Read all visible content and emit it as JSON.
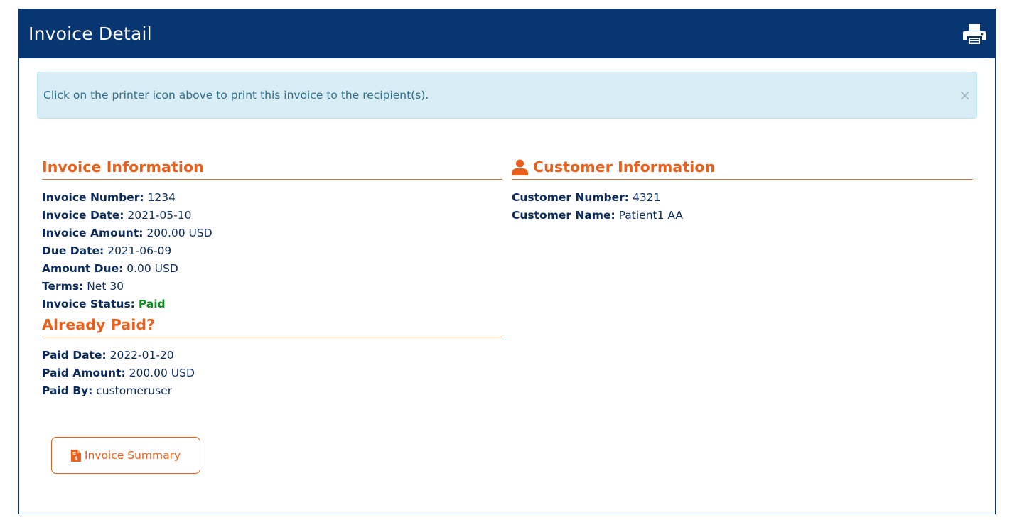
{
  "header": {
    "title": "Invoice Detail",
    "print_icon": "printer-icon"
  },
  "alert": {
    "message": "Click on the printer icon above to print this invoice to the recipient(s).",
    "close_label": "×"
  },
  "invoice_info": {
    "title": "Invoice Information",
    "fields": [
      {
        "label": "Invoice Number:",
        "value": "1234"
      },
      {
        "label": "Invoice Date:",
        "value": "2021-05-10"
      },
      {
        "label": "Invoice Amount:",
        "value": "200.00 USD"
      },
      {
        "label": "Due Date:",
        "value": "2021-06-09"
      },
      {
        "label": "Amount Due:",
        "value": "0.00 USD"
      },
      {
        "label": "Terms:",
        "value": "Net 30"
      },
      {
        "label": "Invoice Status:",
        "value": "Paid"
      }
    ]
  },
  "already_paid": {
    "title": "Already Paid?",
    "fields": [
      {
        "label": "Paid Date:",
        "value": "2022-01-20"
      },
      {
        "label": "Paid Amount:",
        "value": "200.00 USD"
      },
      {
        "label": "Paid By:",
        "value": "customeruser"
      }
    ]
  },
  "customer_info": {
    "title": "Customer Information",
    "icon": "user-icon",
    "fields": [
      {
        "label": "Customer Number:",
        "value": "4321"
      },
      {
        "label": "Customer Name:",
        "value": "Patient1 AA"
      }
    ]
  },
  "summary_button": {
    "label": "Invoice Summary",
    "icon": "invoice-file-icon"
  },
  "colors": {
    "header_bg": "#083672",
    "accent": "#e8601c",
    "paid_status": "#0f8a1f",
    "alert_bg": "#d9edf7"
  }
}
